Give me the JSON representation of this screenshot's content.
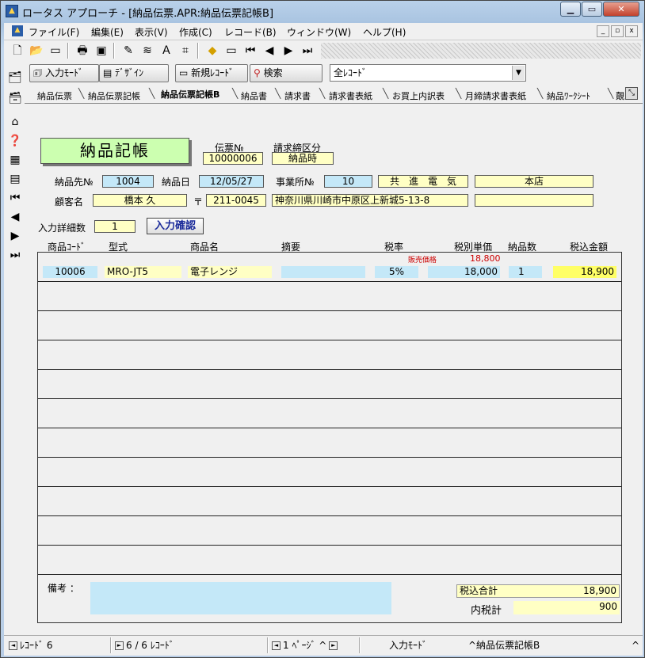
{
  "window": {
    "title": "ロータス アプローチ - [納品伝票.APR:納品伝票記帳B]",
    "min": "▁",
    "max": "▭",
    "close": "✕"
  },
  "menu": [
    "ファイル(F)",
    "編集(E)",
    "表示(V)",
    "作成(C)",
    "レコード(B)",
    "ウィンドウ(W)",
    "ヘルプ(H)"
  ],
  "mdi": {
    "min": "_",
    "restore": "▫",
    "close": "x"
  },
  "toolbar2": {
    "input_mode": "入力ﾓｰﾄﾞ",
    "design": "ﾃﾞｻﾞｲﾝ",
    "new_record": "新規ﾚｺｰﾄﾞ",
    "search": "検索",
    "record_filter": "全ﾚｺｰﾄﾞ"
  },
  "tabs": [
    "納品伝票",
    "納品伝票記帳",
    "納品伝票記帳B",
    "納品書",
    "請求書",
    "請求書表紙",
    "お買上内訳表",
    "月締請求書表紙",
    "納品ﾜｰｸｼｰﾄ",
    "覿"
  ],
  "form": {
    "title": "納品記帳",
    "slip_no_label": "伝票№",
    "slip_no": "10000006",
    "billing_label": "請求締区分",
    "billing": "納品時",
    "customer_no_label": "納品先№",
    "customer_no": "1004",
    "delivery_date_label": "納品日",
    "delivery_date": "12/05/27",
    "office_no_label": "事業所№",
    "office_no": "10",
    "company": "共　進　電　気",
    "branch": "本店",
    "customer_name_label": "顧客名",
    "customer_name": "橋本 久",
    "postal_mark": "〒",
    "postal_code": "211-0045",
    "address": "神奈川県川崎市中原区上新城5-13-8",
    "address2": "",
    "detail_count_label": "入力詳細数",
    "detail_count": "1",
    "confirm_button": "入力確認",
    "columns": [
      "商品ｺｰﾄﾞ",
      "型式",
      "商品名",
      "摘要",
      "税率",
      "税別単価",
      "納品数",
      "税込金額"
    ],
    "retail_label": "販売価格",
    "retail_price": "18,800",
    "row": {
      "code": "10006",
      "model": "MRO-JT5",
      "name": "電子レンジ",
      "memo": "",
      "tax": "5%",
      "unit": "18,000",
      "qty": "1",
      "total": "18,900"
    },
    "notes_label": "備考 ：",
    "notes": "",
    "total_label": "税込合計",
    "total": "18,900",
    "tax_label": "内税計",
    "tax_amount": "900"
  },
  "status": {
    "record": "ﾚｺｰﾄﾞ 6",
    "count": "6 / 6 ﾚｺｰﾄﾞ",
    "page": "1 ﾍﾟｰｼﾞ",
    "mode": "入力ﾓｰﾄﾞ",
    "view": "納品伝票記帳B",
    "caret": "^"
  },
  "colors": {
    "title_bg": "#ccffb0",
    "cyan_field": "#c4e8f8",
    "yellow_field": "#ffffc4",
    "red_text": "#cc0000",
    "blue_button_text": "#1a2a9a"
  }
}
